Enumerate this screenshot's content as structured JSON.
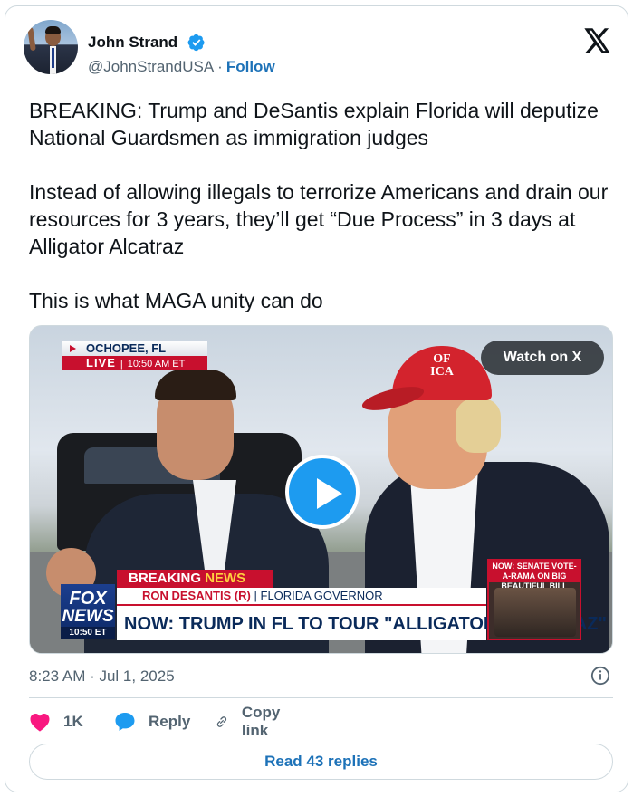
{
  "author": {
    "name": "John Strand",
    "handle": "@JohnStrandUSA",
    "separator": "·",
    "follow_label": "Follow",
    "verified_color": "#1d9bf0"
  },
  "tweet": {
    "paragraphs": [
      "BREAKING: Trump and DeSantis explain Florida will deputize National Guardsmen as immigration judges",
      "Instead of allowing illegals to terrorize Americans and drain our resources for 3 years, they’ll get “Due Process” in 3 days at Alligator Alcatraz",
      "This is what MAGA unity can do"
    ]
  },
  "media": {
    "watch_label": "Watch on X",
    "location": "OCHOPEE, FL",
    "live_label": "LIVE",
    "live_time": "10:50 AM ET",
    "cap_text": "OF\nICA",
    "breaking_label": "BREAKING",
    "breaking_news_label": "NEWS",
    "speaker_name": "RON DESANTIS (R)",
    "speaker_title": "FLORIDA GOVERNOR",
    "headline": "NOW: TRUMP IN FL TO TOUR \"ALLIGATOR ALCATRAZ\"",
    "network_top": "FOX",
    "network_bottom": "NEWS",
    "network_time": "10:50 ET",
    "side_label": "NOW: SENATE VOTE-A-RAMA ON BIG BEAUTIFUL BILL",
    "play_color": "#1d9bf0"
  },
  "footer": {
    "timestamp": "8:23 AM · Jul 1, 2025",
    "like_count": "1K",
    "reply_label": "Reply",
    "copy_link_label": "Copy link",
    "read_replies_label": "Read 43 replies",
    "like_color": "#f91880",
    "reply_color": "#1d9bf0"
  }
}
